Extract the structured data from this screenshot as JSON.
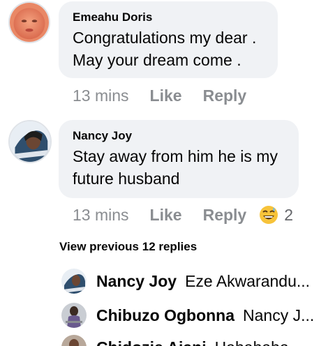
{
  "comments": [
    {
      "author": "Emeahu Doris",
      "lines": [
        "Congratulations my dear .",
        "May your dream come ."
      ],
      "time": "13 mins",
      "like_label": "Like",
      "reply_label": "Reply"
    },
    {
      "author": "Nancy Joy",
      "lines": [
        "Stay away from him he is my",
        "future husband"
      ],
      "time": "13 mins",
      "like_label": "Like",
      "reply_label": "Reply",
      "reaction_icon": "grinning-sweat-emoji-icon",
      "reaction_count": "2"
    }
  ],
  "view_previous_label": "View previous 12 replies",
  "replies": [
    {
      "author": "Nancy Joy",
      "preview": "Eze Akwarandu..."
    },
    {
      "author": "Chibuzo Ogbonna",
      "preview": "Nancy J..."
    },
    {
      "author": "Chidozie Ajani",
      "preview": "Hahahaha"
    }
  ],
  "colors": {
    "bubble": "#f0f2f5",
    "meta_text": "#8a8d91",
    "reaction_yellow": "#f7c33a"
  }
}
